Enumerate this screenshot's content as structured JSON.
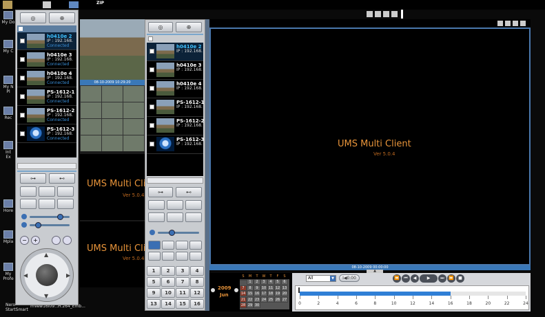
{
  "desktop": {
    "top_icon_label": "ZIP",
    "icons": [
      {
        "label": "My Do"
      },
      {
        "label": "My C"
      },
      {
        "label": "My N\nPl"
      },
      {
        "label": "Rec"
      },
      {
        "label": "Int\nEx"
      },
      {
        "label": "Hore"
      },
      {
        "label": "Mpla"
      },
      {
        "label": "My\nProfe"
      }
    ],
    "taskbar": [
      {
        "label": "Nero\nStartSmart"
      },
      {
        "label": "mVew16l09..."
      },
      {
        "label": "H.264_Emb..."
      }
    ]
  },
  "left_panel": {
    "devices": [
      {
        "name": "h0410e 2",
        "ip": "IP : 192.168.",
        "status": "Connected",
        "selected": true
      },
      {
        "name": "h0410e 3",
        "ip": "IP : 192.168.",
        "status": "Connected"
      },
      {
        "name": "h0410e 4",
        "ip": "IP : 192.168.",
        "status": "Connected"
      },
      {
        "name": "PS-1612-1",
        "ip": "IP : 192.168.",
        "status": "Connected"
      },
      {
        "name": "PS-1612-2",
        "ip": "IP : 192.168.",
        "status": "Connected"
      },
      {
        "name": "PS-1612-3",
        "ip": "IP : 192.168.",
        "status": "Connected"
      }
    ]
  },
  "mid_left": {
    "timestamp": "08-10-2009 10:29:20",
    "app_title": "UMS Multi Clie",
    "app_title2": "UMS Multi Clie",
    "version": "Ver 5.0.4",
    "version2": "Ver 5.0.4"
  },
  "mid_panel": {
    "devices": [
      {
        "name": "h0410e 2",
        "ip": "IP : 192.168.",
        "selected": true
      },
      {
        "name": "h0410e 3",
        "ip": "IP : 192.168."
      },
      {
        "name": "h0410e 4",
        "ip": "IP : 192.168."
      },
      {
        "name": "PS-1612-1",
        "ip": "IP : 192.168."
      },
      {
        "name": "PS-1612-2",
        "ip": "IP : 192.168."
      },
      {
        "name": "PS-1612-3",
        "ip": "IP : 192.168."
      }
    ],
    "numpad": [
      "1",
      "2",
      "3",
      "4",
      "5",
      "6",
      "7",
      "8",
      "9",
      "10",
      "11",
      "12",
      "13",
      "14",
      "15",
      "16"
    ]
  },
  "main_view": {
    "app_title": "UMS Multi Client",
    "version": "Ver 5.0.4",
    "timestamp": "08-10-2009 00:00:00"
  },
  "playback": {
    "year": "2009",
    "month": "Jun",
    "weekdays": [
      "S",
      "M",
      "T",
      "W",
      "T",
      "F",
      "S"
    ],
    "days": [
      "",
      "1",
      "2",
      "3",
      "4",
      "5",
      "6",
      "7",
      "8",
      "9",
      "10",
      "11",
      "12",
      "13",
      "14",
      "15",
      "16",
      "17",
      "18",
      "19",
      "20",
      "21",
      "22",
      "23",
      "24",
      "25",
      "26",
      "27",
      "28",
      "29",
      "30"
    ],
    "filter_value": "All",
    "goto_label": "I◀0:00",
    "timeline_ticks": [
      "0",
      "2",
      "4",
      "6",
      "8",
      "10",
      "12",
      "14",
      "16",
      "18",
      "20",
      "22",
      "24"
    ],
    "recorded_fraction": 0.667,
    "colors": {
      "recorded": "#2f7fd6",
      "accent": "#e8943a"
    }
  }
}
